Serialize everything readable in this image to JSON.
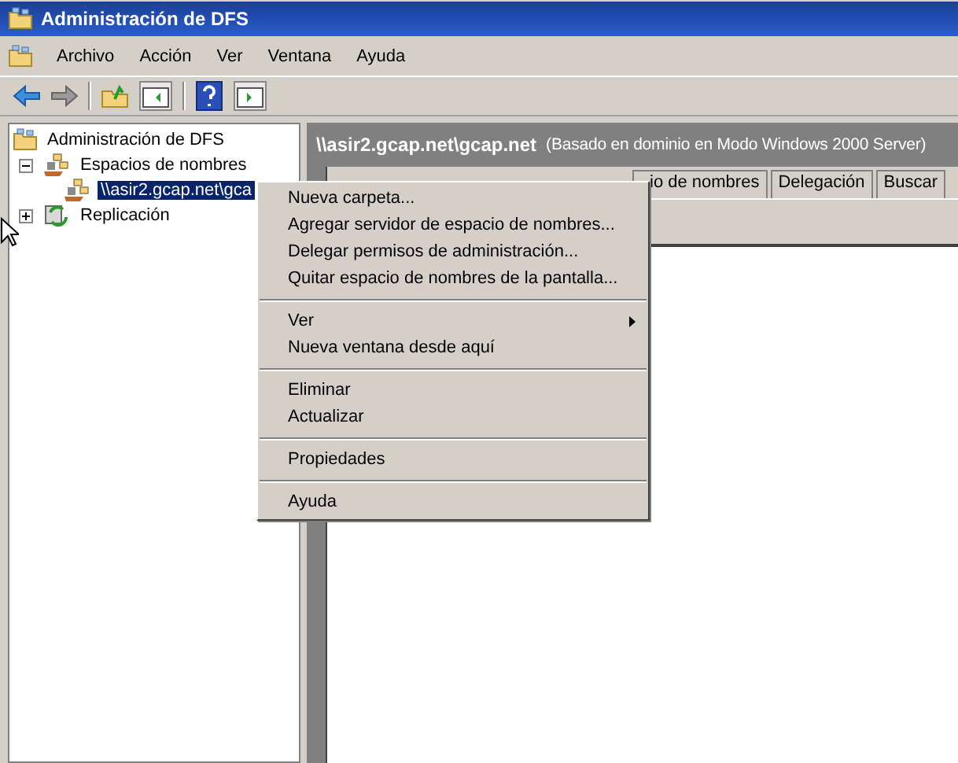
{
  "window": {
    "title": "Administración de DFS"
  },
  "menu_bar": [
    "Archivo",
    "Acción",
    "Ver",
    "Ventana",
    "Ayuda"
  ],
  "tree": [
    {
      "label": "Administración de DFS",
      "children": [
        {
          "label": "Espacios de nombres",
          "expanded": true,
          "children": [
            {
              "label": "\\\\asir2.gcap.net\\gca",
              "selected": true
            }
          ]
        },
        {
          "label": "Replicación",
          "expanded": false
        }
      ]
    }
  ],
  "panel": {
    "title": "\\\\asir2.gcap.net\\gcap.net",
    "subtitle": "(Basado en dominio en Modo Windows 2000 Server)"
  },
  "tabs": [
    {
      "label": "io de nombres",
      "selected": false
    },
    {
      "label": "Delegación",
      "selected": false
    },
    {
      "label": "Buscar",
      "selected": false
    }
  ],
  "context_menu": [
    {
      "kind": "item",
      "label": "Nueva carpeta..."
    },
    {
      "kind": "item",
      "label": "Agregar servidor de espacio de nombres..."
    },
    {
      "kind": "item",
      "label": "Delegar permisos de administración..."
    },
    {
      "kind": "item",
      "label": "Quitar espacio de nombres de la pantalla..."
    },
    {
      "kind": "separator"
    },
    {
      "kind": "submenu",
      "label": "Ver"
    },
    {
      "kind": "item",
      "label": "Nueva ventana desde aquí"
    },
    {
      "kind": "separator"
    },
    {
      "kind": "item",
      "label": "Eliminar"
    },
    {
      "kind": "item",
      "label": "Actualizar"
    },
    {
      "kind": "separator"
    },
    {
      "kind": "item",
      "label": "Propiedades"
    },
    {
      "kind": "separator"
    },
    {
      "kind": "item",
      "label": "Ayuda"
    }
  ]
}
